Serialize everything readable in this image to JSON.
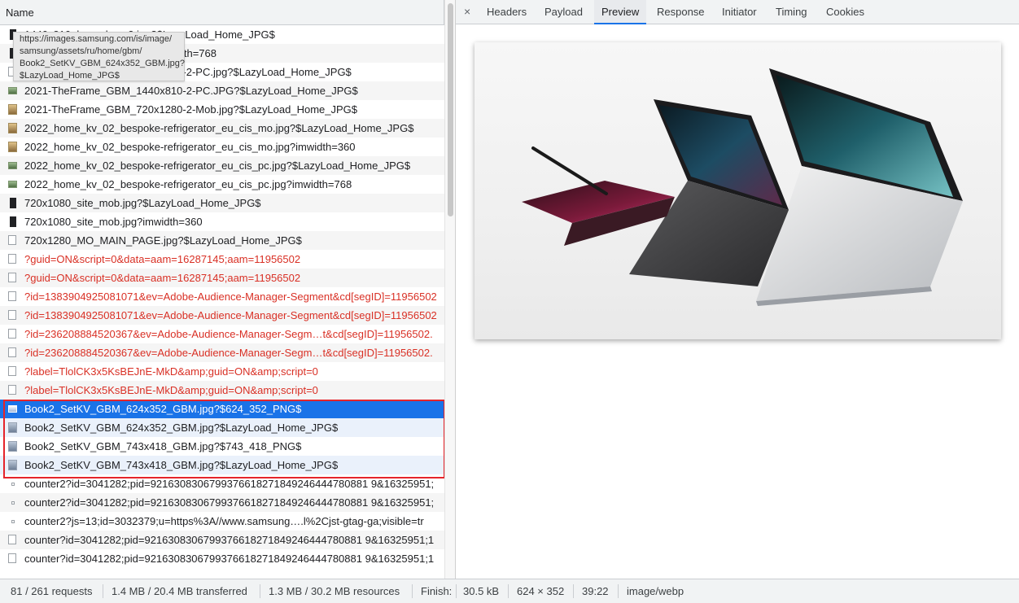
{
  "left_pane": {
    "column_name": "Name",
    "tooltip_lines": [
      "https://images.samsung.com/is/image/",
      "samsung/assets/ru/home/gbm/",
      "Book2_SetKV_GBM_624x352_GBM.jpg?",
      "$LazyLoad_Home_JPG$"
    ],
    "partial_rows": [
      "1440x810_bespoke_v2.jpg?$LazyLoad_Home_JPG$",
      "1440x810_bespoke_v2.jpg?imwidth=768",
      "2021-TheFrame_GBM_1440x810-2-PC.jpg?$LazyLoad_Home_JPG$"
    ],
    "requests": [
      {
        "name": "2021-TheFrame_GBM_1440x810-2-PC.JPG?$LazyLoad_Home_JPG$",
        "icon": "image-icon"
      },
      {
        "name": "2021-TheFrame_GBM_720x1280-2-Mob.jpg?$LazyLoad_Home_JPG$",
        "icon": "image-icon"
      },
      {
        "name": "2022_home_kv_02_bespoke-refrigerator_eu_cis_mo.jpg?$LazyLoad_Home_JPG$",
        "icon": "image-icon"
      },
      {
        "name": "2022_home_kv_02_bespoke-refrigerator_eu_cis_mo.jpg?imwidth=360",
        "icon": "image-icon"
      },
      {
        "name": "2022_home_kv_02_bespoke-refrigerator_eu_cis_pc.jpg?$LazyLoad_Home_JPG$",
        "icon": "image-icon"
      },
      {
        "name": "2022_home_kv_02_bespoke-refrigerator_eu_cis_pc.jpg?imwidth=768",
        "icon": "image-icon"
      },
      {
        "name": "720x1080_site_mob.jpg?$LazyLoad_Home_JPG$",
        "icon": "image-icon"
      },
      {
        "name": "720x1080_site_mob.jpg?imwidth=360",
        "icon": "image-icon"
      },
      {
        "name": "720x1280_MO_MAIN_PAGE.jpg?$LazyLoad_Home_JPG$",
        "icon": "document-icon"
      },
      {
        "name": "?guid=ON&script=0&data=aam=16287145;aam=11956502",
        "icon": "document-icon",
        "error": true
      },
      {
        "name": "?guid=ON&script=0&data=aam=16287145;aam=11956502",
        "icon": "document-icon",
        "error": true
      },
      {
        "name": "?id=1383904925081071&ev=Adobe-Audience-Manager-Segment&cd[segID]=11956502",
        "icon": "document-icon",
        "error": true
      },
      {
        "name": "?id=1383904925081071&ev=Adobe-Audience-Manager-Segment&cd[segID]=11956502",
        "icon": "document-icon",
        "error": true
      },
      {
        "name": "?id=236208884520367&ev=Adobe-Audience-Manager-Segm…t&cd[segID]=11956502.",
        "icon": "document-icon",
        "error": true
      },
      {
        "name": "?id=236208884520367&ev=Adobe-Audience-Manager-Segm…t&cd[segID]=11956502.",
        "icon": "document-icon",
        "error": true
      },
      {
        "name": "?label=TlolCK3x5KsBEJnE-MkD&amp;guid=ON&amp;script=0",
        "icon": "document-icon",
        "error": true
      },
      {
        "name": "?label=TlolCK3x5KsBEJnE-MkD&amp;guid=ON&amp;script=0",
        "icon": "document-icon",
        "error": true
      },
      {
        "name": "Book2_SetKV_GBM_624x352_GBM.jpg?$624_352_PNG$",
        "icon": "image-icon",
        "selected": true
      },
      {
        "name": "Book2_SetKV_GBM_624x352_GBM.jpg?$LazyLoad_Home_JPG$",
        "icon": "image-icon"
      },
      {
        "name": "Book2_SetKV_GBM_743x418_GBM.jpg?$743_418_PNG$",
        "icon": "image-icon"
      },
      {
        "name": "Book2_SetKV_GBM_743x418_GBM.jpg?$LazyLoad_Home_JPG$",
        "icon": "image-icon"
      },
      {
        "name": "counter2?id=3041282;pid=9216308306799376618271849246444780881 9&16325951;",
        "icon": "dot-icon"
      },
      {
        "name": "counter2?id=3041282;pid=9216308306799376618271849246444780881 9&16325951;",
        "icon": "dot-icon"
      },
      {
        "name": "counter2?js=13;id=3032379;u=https%3A//www.samsung….l%2Cjst-gtag-ga;visible=tr",
        "icon": "dot-icon"
      },
      {
        "name": "counter?id=3041282;pid=9216308306799376618271849246444780881 9&16325951;1",
        "icon": "document-icon"
      },
      {
        "name": "counter?id=3041282;pid=9216308306799376618271849246444780881 9&16325951;1",
        "icon": "document-icon"
      }
    ]
  },
  "right_pane": {
    "close_glyph": "×",
    "tabs": [
      "Headers",
      "Payload",
      "Preview",
      "Response",
      "Initiator",
      "Timing",
      "Cookies"
    ],
    "active_tab": "Preview"
  },
  "footer": {
    "requests": "81 / 261 requests",
    "transferred": "1.4 MB / 20.4 MB transferred",
    "resources": "1.3 MB / 30.2 MB resources",
    "finish": "Finish:",
    "size": "30.5 kB",
    "dimensions": "624 × 352",
    "ratio": "39:22",
    "mime": "image/webp"
  },
  "colors": {
    "accent": "#1a73e8",
    "error_text": "#d93025",
    "highlight_border": "#e5242a"
  }
}
